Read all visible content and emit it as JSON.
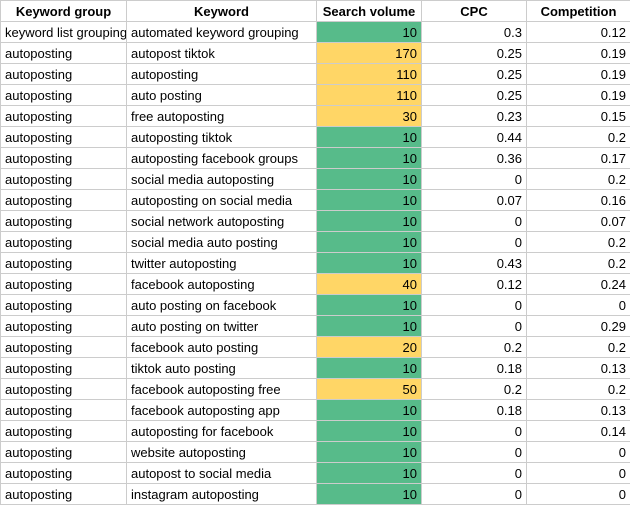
{
  "headers": {
    "group": "Keyword group",
    "keyword": "Keyword",
    "volume": "Search volume",
    "cpc": "CPC",
    "competition": "Competition"
  },
  "rows": [
    {
      "group": "keyword list grouping",
      "keyword": "automated keyword grouping",
      "volume": 10,
      "volume_color": "green",
      "cpc": "0.3",
      "competition": "0.12"
    },
    {
      "group": "autoposting",
      "keyword": "autopost tiktok",
      "volume": 170,
      "volume_color": "yellow",
      "cpc": "0.25",
      "competition": "0.19"
    },
    {
      "group": "autoposting",
      "keyword": "autoposting",
      "volume": 110,
      "volume_color": "yellow",
      "cpc": "0.25",
      "competition": "0.19"
    },
    {
      "group": "autoposting",
      "keyword": "auto posting",
      "volume": 110,
      "volume_color": "yellow",
      "cpc": "0.25",
      "competition": "0.19"
    },
    {
      "group": "autoposting",
      "keyword": "free autoposting",
      "volume": 30,
      "volume_color": "yellow",
      "cpc": "0.23",
      "competition": "0.15"
    },
    {
      "group": "autoposting",
      "keyword": "autoposting tiktok",
      "volume": 10,
      "volume_color": "green",
      "cpc": "0.44",
      "competition": "0.2"
    },
    {
      "group": "autoposting",
      "keyword": "autoposting facebook groups",
      "volume": 10,
      "volume_color": "green",
      "cpc": "0.36",
      "competition": "0.17"
    },
    {
      "group": "autoposting",
      "keyword": "social media autoposting",
      "volume": 10,
      "volume_color": "green",
      "cpc": "0",
      "competition": "0.2"
    },
    {
      "group": "autoposting",
      "keyword": "autoposting on social media",
      "volume": 10,
      "volume_color": "green",
      "cpc": "0.07",
      "competition": "0.16"
    },
    {
      "group": "autoposting",
      "keyword": "social network autoposting",
      "volume": 10,
      "volume_color": "green",
      "cpc": "0",
      "competition": "0.07"
    },
    {
      "group": "autoposting",
      "keyword": "social media auto posting",
      "volume": 10,
      "volume_color": "green",
      "cpc": "0",
      "competition": "0.2"
    },
    {
      "group": "autoposting",
      "keyword": "twitter autoposting",
      "volume": 10,
      "volume_color": "green",
      "cpc": "0.43",
      "competition": "0.2"
    },
    {
      "group": "autoposting",
      "keyword": "facebook autoposting",
      "volume": 40,
      "volume_color": "yellow",
      "cpc": "0.12",
      "competition": "0.24"
    },
    {
      "group": "autoposting",
      "keyword": "auto posting on facebook",
      "volume": 10,
      "volume_color": "green",
      "cpc": "0",
      "competition": "0"
    },
    {
      "group": "autoposting",
      "keyword": "auto posting on twitter",
      "volume": 10,
      "volume_color": "green",
      "cpc": "0",
      "competition": "0.29"
    },
    {
      "group": "autoposting",
      "keyword": "facebook auto posting",
      "volume": 20,
      "volume_color": "yellow",
      "cpc": "0.2",
      "competition": "0.2"
    },
    {
      "group": "autoposting",
      "keyword": "tiktok auto posting",
      "volume": 10,
      "volume_color": "green",
      "cpc": "0.18",
      "competition": "0.13"
    },
    {
      "group": "autoposting",
      "keyword": "facebook autoposting free",
      "volume": 50,
      "volume_color": "yellow",
      "cpc": "0.2",
      "competition": "0.2"
    },
    {
      "group": "autoposting",
      "keyword": "facebook autoposting app",
      "volume": 10,
      "volume_color": "green",
      "cpc": "0.18",
      "competition": "0.13"
    },
    {
      "group": "autoposting",
      "keyword": "autoposting for facebook",
      "volume": 10,
      "volume_color": "green",
      "cpc": "0",
      "competition": "0.14"
    },
    {
      "group": "autoposting",
      "keyword": "website autoposting",
      "volume": 10,
      "volume_color": "green",
      "cpc": "0",
      "competition": "0"
    },
    {
      "group": "autoposting",
      "keyword": "autopost to social media",
      "volume": 10,
      "volume_color": "green",
      "cpc": "0",
      "competition": "0"
    },
    {
      "group": "autoposting",
      "keyword": "instagram autoposting",
      "volume": 10,
      "volume_color": "green",
      "cpc": "0",
      "competition": "0"
    }
  ]
}
